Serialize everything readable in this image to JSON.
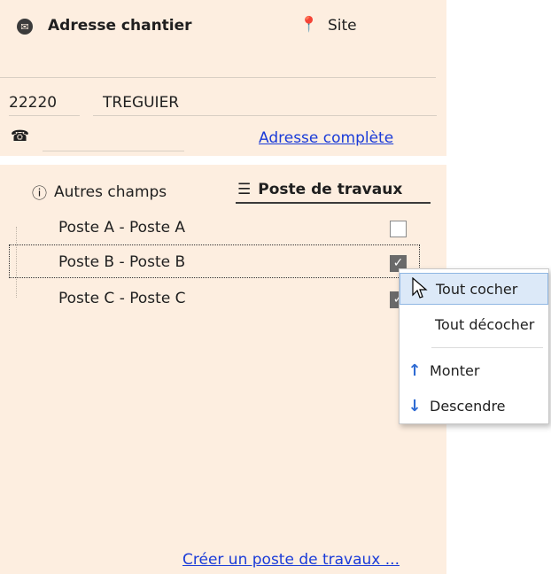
{
  "top": {
    "address_title": "Adresse chantier",
    "site_label": "Site",
    "postal_code": "22220",
    "city": "TREGUIER",
    "phone_value": "",
    "full_address_link": "Adresse complète"
  },
  "tabs": {
    "other_fields": "Autres champs",
    "work_posts": "Poste de travaux"
  },
  "posts": [
    {
      "label": "Poste A - Poste A",
      "checked": false
    },
    {
      "label": "Poste B - Poste B",
      "checked": true
    },
    {
      "label": "Poste C - Poste C",
      "checked": true
    }
  ],
  "create_link": "Créer un poste de travaux ...",
  "context_menu": {
    "check_all": "Tout cocher",
    "uncheck_all": "Tout décocher",
    "move_up": "Monter",
    "move_down": "Descendre"
  }
}
